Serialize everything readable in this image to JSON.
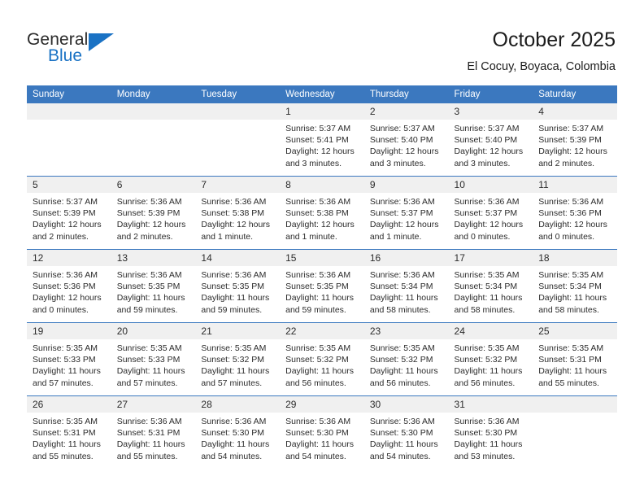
{
  "logo": {
    "word_one": "General",
    "word_two": "Blue",
    "triangle_color": "#1a72c4"
  },
  "header": {
    "title": "October 2025",
    "subtitle": "El Cocuy, Boyaca, Colombia"
  },
  "theme": {
    "header_blue": "#3b78bf",
    "daynum_gray": "#f0f0f0",
    "text": "#2b2b2b"
  },
  "labels": {
    "sunrise_prefix": "Sunrise:",
    "sunset_prefix": "Sunset:",
    "daylight_prefix": "Daylight:"
  },
  "weekday_headers": [
    "Sunday",
    "Monday",
    "Tuesday",
    "Wednesday",
    "Thursday",
    "Friday",
    "Saturday"
  ],
  "weeks": [
    [
      {
        "day": "",
        "empty": true
      },
      {
        "day": "",
        "empty": true
      },
      {
        "day": "",
        "empty": true
      },
      {
        "day": "1",
        "sunrise": "Sunrise: 5:37 AM",
        "sunset": "Sunset: 5:41 PM",
        "daylight": "Daylight: 12 hours and 3 minutes."
      },
      {
        "day": "2",
        "sunrise": "Sunrise: 5:37 AM",
        "sunset": "Sunset: 5:40 PM",
        "daylight": "Daylight: 12 hours and 3 minutes."
      },
      {
        "day": "3",
        "sunrise": "Sunrise: 5:37 AM",
        "sunset": "Sunset: 5:40 PM",
        "daylight": "Daylight: 12 hours and 3 minutes."
      },
      {
        "day": "4",
        "sunrise": "Sunrise: 5:37 AM",
        "sunset": "Sunset: 5:39 PM",
        "daylight": "Daylight: 12 hours and 2 minutes."
      }
    ],
    [
      {
        "day": "5",
        "sunrise": "Sunrise: 5:37 AM",
        "sunset": "Sunset: 5:39 PM",
        "daylight": "Daylight: 12 hours and 2 minutes."
      },
      {
        "day": "6",
        "sunrise": "Sunrise: 5:36 AM",
        "sunset": "Sunset: 5:39 PM",
        "daylight": "Daylight: 12 hours and 2 minutes."
      },
      {
        "day": "7",
        "sunrise": "Sunrise: 5:36 AM",
        "sunset": "Sunset: 5:38 PM",
        "daylight": "Daylight: 12 hours and 1 minute."
      },
      {
        "day": "8",
        "sunrise": "Sunrise: 5:36 AM",
        "sunset": "Sunset: 5:38 PM",
        "daylight": "Daylight: 12 hours and 1 minute."
      },
      {
        "day": "9",
        "sunrise": "Sunrise: 5:36 AM",
        "sunset": "Sunset: 5:37 PM",
        "daylight": "Daylight: 12 hours and 1 minute."
      },
      {
        "day": "10",
        "sunrise": "Sunrise: 5:36 AM",
        "sunset": "Sunset: 5:37 PM",
        "daylight": "Daylight: 12 hours and 0 minutes."
      },
      {
        "day": "11",
        "sunrise": "Sunrise: 5:36 AM",
        "sunset": "Sunset: 5:36 PM",
        "daylight": "Daylight: 12 hours and 0 minutes."
      }
    ],
    [
      {
        "day": "12",
        "sunrise": "Sunrise: 5:36 AM",
        "sunset": "Sunset: 5:36 PM",
        "daylight": "Daylight: 12 hours and 0 minutes."
      },
      {
        "day": "13",
        "sunrise": "Sunrise: 5:36 AM",
        "sunset": "Sunset: 5:35 PM",
        "daylight": "Daylight: 11 hours and 59 minutes."
      },
      {
        "day": "14",
        "sunrise": "Sunrise: 5:36 AM",
        "sunset": "Sunset: 5:35 PM",
        "daylight": "Daylight: 11 hours and 59 minutes."
      },
      {
        "day": "15",
        "sunrise": "Sunrise: 5:36 AM",
        "sunset": "Sunset: 5:35 PM",
        "daylight": "Daylight: 11 hours and 59 minutes."
      },
      {
        "day": "16",
        "sunrise": "Sunrise: 5:36 AM",
        "sunset": "Sunset: 5:34 PM",
        "daylight": "Daylight: 11 hours and 58 minutes."
      },
      {
        "day": "17",
        "sunrise": "Sunrise: 5:35 AM",
        "sunset": "Sunset: 5:34 PM",
        "daylight": "Daylight: 11 hours and 58 minutes."
      },
      {
        "day": "18",
        "sunrise": "Sunrise: 5:35 AM",
        "sunset": "Sunset: 5:34 PM",
        "daylight": "Daylight: 11 hours and 58 minutes."
      }
    ],
    [
      {
        "day": "19",
        "sunrise": "Sunrise: 5:35 AM",
        "sunset": "Sunset: 5:33 PM",
        "daylight": "Daylight: 11 hours and 57 minutes."
      },
      {
        "day": "20",
        "sunrise": "Sunrise: 5:35 AM",
        "sunset": "Sunset: 5:33 PM",
        "daylight": "Daylight: 11 hours and 57 minutes."
      },
      {
        "day": "21",
        "sunrise": "Sunrise: 5:35 AM",
        "sunset": "Sunset: 5:32 PM",
        "daylight": "Daylight: 11 hours and 57 minutes."
      },
      {
        "day": "22",
        "sunrise": "Sunrise: 5:35 AM",
        "sunset": "Sunset: 5:32 PM",
        "daylight": "Daylight: 11 hours and 56 minutes."
      },
      {
        "day": "23",
        "sunrise": "Sunrise: 5:35 AM",
        "sunset": "Sunset: 5:32 PM",
        "daylight": "Daylight: 11 hours and 56 minutes."
      },
      {
        "day": "24",
        "sunrise": "Sunrise: 5:35 AM",
        "sunset": "Sunset: 5:32 PM",
        "daylight": "Daylight: 11 hours and 56 minutes."
      },
      {
        "day": "25",
        "sunrise": "Sunrise: 5:35 AM",
        "sunset": "Sunset: 5:31 PM",
        "daylight": "Daylight: 11 hours and 55 minutes."
      }
    ],
    [
      {
        "day": "26",
        "sunrise": "Sunrise: 5:35 AM",
        "sunset": "Sunset: 5:31 PM",
        "daylight": "Daylight: 11 hours and 55 minutes."
      },
      {
        "day": "27",
        "sunrise": "Sunrise: 5:36 AM",
        "sunset": "Sunset: 5:31 PM",
        "daylight": "Daylight: 11 hours and 55 minutes."
      },
      {
        "day": "28",
        "sunrise": "Sunrise: 5:36 AM",
        "sunset": "Sunset: 5:30 PM",
        "daylight": "Daylight: 11 hours and 54 minutes."
      },
      {
        "day": "29",
        "sunrise": "Sunrise: 5:36 AM",
        "sunset": "Sunset: 5:30 PM",
        "daylight": "Daylight: 11 hours and 54 minutes."
      },
      {
        "day": "30",
        "sunrise": "Sunrise: 5:36 AM",
        "sunset": "Sunset: 5:30 PM",
        "daylight": "Daylight: 11 hours and 54 minutes."
      },
      {
        "day": "31",
        "sunrise": "Sunrise: 5:36 AM",
        "sunset": "Sunset: 5:30 PM",
        "daylight": "Daylight: 11 hours and 53 minutes."
      },
      {
        "day": "",
        "empty": true
      }
    ]
  ]
}
